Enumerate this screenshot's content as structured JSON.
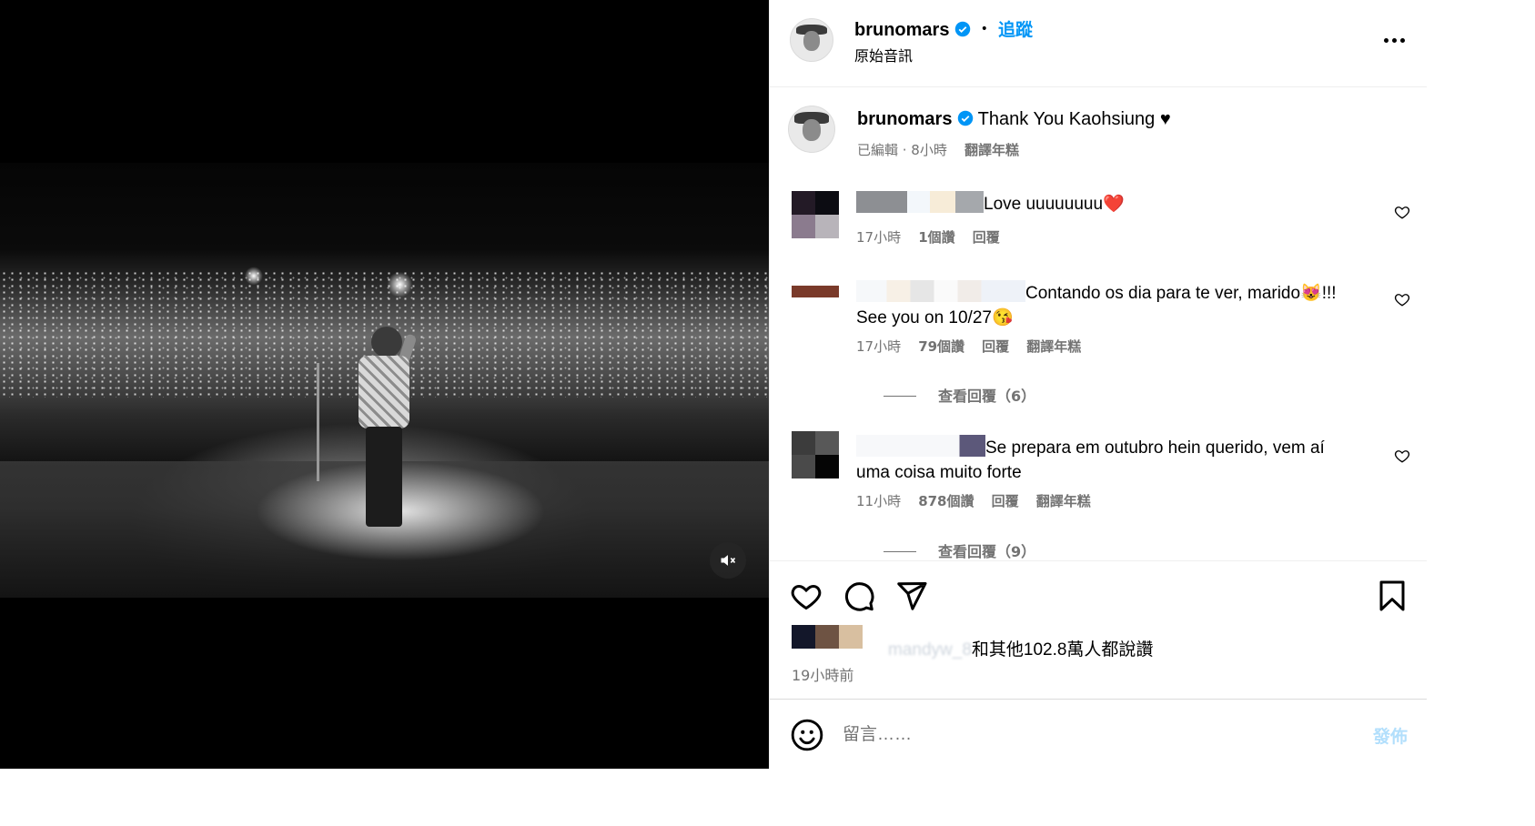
{
  "post": {
    "username": "brunomars",
    "follow_label": "追蹤",
    "audio_label": "原始音訊",
    "caption": "Thank You Kaohsiung ♥",
    "caption_meta": "已編輯 · 8小時",
    "translate_label": "翻譯年糕"
  },
  "comments": [
    {
      "text": "Love uuuuuuuu",
      "emoji": "❤️",
      "time": "17小時",
      "likes": "1個讚",
      "reply": "回覆",
      "translate": ""
    },
    {
      "text": "Contando os dia para te ver, marido",
      "emoji_mid": "😻",
      "text_after": "!!!",
      "line2": "See you on 10/27",
      "emoji_end": "😘",
      "time": "17小時",
      "likes": "79個讚",
      "reply": "回覆",
      "translate": "翻譯年糕",
      "view_replies": "查看回覆（6）"
    },
    {
      "text": "Se prepara em outubro hein querido, vem aí",
      "line2": "uma coisa muito forte",
      "time": "11小時",
      "likes": "878個讚",
      "reply": "回覆",
      "translate": "翻譯年糕",
      "view_replies": "查看回覆（9）"
    }
  ],
  "likes_summary": {
    "blurred_name": "mandyw_8",
    "text": "和其他102.8萬人都說讚",
    "time_ago": "19小時前"
  },
  "composer": {
    "placeholder": "留言……",
    "post_label": "發佈"
  },
  "icons": {
    "mute": "speaker-muted-icon",
    "like": "heart-icon",
    "comment": "speech-bubble-icon",
    "share": "paper-plane-icon",
    "save": "bookmark-icon",
    "emoji": "smiley-icon",
    "more": "more-options-icon",
    "verified": "verified-badge-icon"
  },
  "colors": {
    "accent": "#0095f6",
    "verified": "#0095f6",
    "muted_text": "#737373",
    "post_disabled": "#b2dffc"
  }
}
